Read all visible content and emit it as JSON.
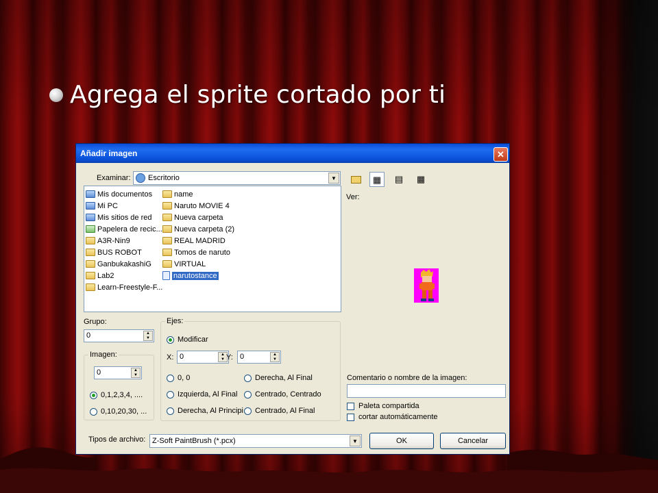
{
  "slide": {
    "bullet_text": "Agrega el sprite cortado por ti"
  },
  "dialog": {
    "title": "Añadir imagen",
    "close_glyph": "✕",
    "examinar_label": "Examinar:",
    "location_value": "Escritorio",
    "ver_label": "Ver:",
    "files_col1": [
      {
        "name": "Mis documentos",
        "icon": "my-documents-icon"
      },
      {
        "name": "Mi PC",
        "icon": "my-computer-icon"
      },
      {
        "name": "Mis sitios de red",
        "icon": "network-places-icon"
      },
      {
        "name": "Papelera de recic...",
        "icon": "recycle-bin-icon"
      },
      {
        "name": "A3R-Nin9",
        "icon": "folder-icon"
      },
      {
        "name": "BUS ROBOT",
        "icon": "folder-icon"
      },
      {
        "name": "GanbukakashiG",
        "icon": "folder-icon"
      },
      {
        "name": "Lab2",
        "icon": "folder-icon"
      },
      {
        "name": "Learn-Freestyle-F...",
        "icon": "folder-icon"
      }
    ],
    "files_col2": [
      {
        "name": "name",
        "icon": "folder-icon"
      },
      {
        "name": "Naruto MOVIE 4",
        "icon": "folder-icon"
      },
      {
        "name": "Nueva carpeta",
        "icon": "folder-icon"
      },
      {
        "name": "Nueva carpeta (2)",
        "icon": "folder-icon"
      },
      {
        "name": "REAL MADRID",
        "icon": "folder-icon"
      },
      {
        "name": "Tomos de naruto",
        "icon": "folder-icon"
      },
      {
        "name": "VIRTUAL",
        "icon": "folder-icon"
      },
      {
        "name": "narutostance",
        "icon": "image-file-icon",
        "selected": true
      }
    ],
    "grupo_label": "Grupo:",
    "grupo_value": "0",
    "imagen_label": "Imagen:",
    "imagen_value": "0",
    "imagen_radio_1": "0,1,2,3,4, ....",
    "imagen_radio_2": "0,10,20,30, ...",
    "ejes_label": "Ejes:",
    "modificar_label": "Modificar",
    "x_label": "X:",
    "x_value": "0",
    "y_label": "Y:",
    "y_value": "0",
    "ejes_options": [
      "0, 0",
      "Derecha, Al Final",
      "Izquierda, Al Final",
      "Centrado, Centrado",
      "Derecha, Al Principi",
      "Centrado, Al Final"
    ],
    "comentario_label": "Comentario o nombre de la imagen:",
    "comentario_value": "",
    "paleta_label": "Paleta compartida",
    "cortar_label": "cortar automáticamente",
    "tipos_label": "Tipos de archivo:",
    "tipos_value": "Z-Soft PaintBrush (*.pcx)",
    "ok_label": "OK",
    "cancel_label": "Cancelar"
  },
  "colors": {
    "titlebar": "#0a4dd8",
    "dialog_face": "#ece9d8",
    "selection": "#316ac5",
    "sprite_background": "#ff00ff"
  }
}
